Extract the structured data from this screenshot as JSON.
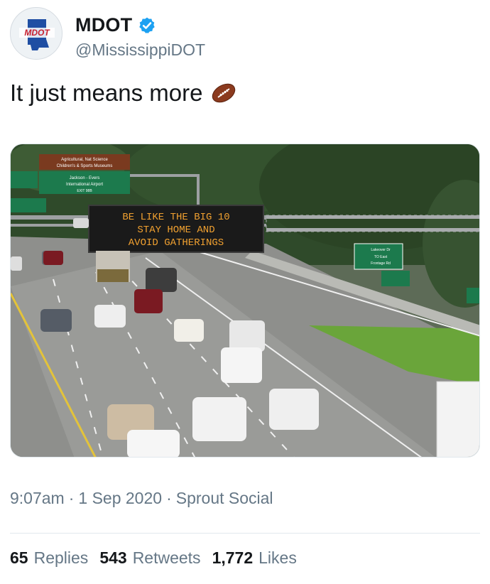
{
  "author": {
    "display_name": "MDOT",
    "handle": "@MississippiDOT",
    "avatar_text": "MDOT",
    "verified": true,
    "accent_color": "#1da1f2"
  },
  "tweet": {
    "text": "It just means more",
    "emoji": "football-icon"
  },
  "media": {
    "sign_overhead_green_1": "Agricultural, Nat Science",
    "sign_overhead_green_2": "Children's & Sports Museums",
    "sign_airport_1": "Jackson - Evers",
    "sign_airport_2": "International Airport",
    "sign_exit": "EXIT 98B",
    "message_line_1": "BE LIKE THE BIG 10",
    "message_line_2": "STAY HOME AND",
    "message_line_3": "AVOID GATHERINGS",
    "right_sign_1": "Lakeover Dr",
    "right_sign_2": "TO East",
    "right_sign_3": "Frontage Rd",
    "message_color": "#f0a030"
  },
  "meta": {
    "time": "9:07am",
    "sep1": "·",
    "date": "1 Sep 2020",
    "sep2": "·",
    "source": "Sprout Social"
  },
  "stats": {
    "replies_count": "65",
    "replies_label": "Replies",
    "retweets_count": "543",
    "retweets_label": "Retweets",
    "likes_count": "1,772",
    "likes_label": "Likes"
  }
}
